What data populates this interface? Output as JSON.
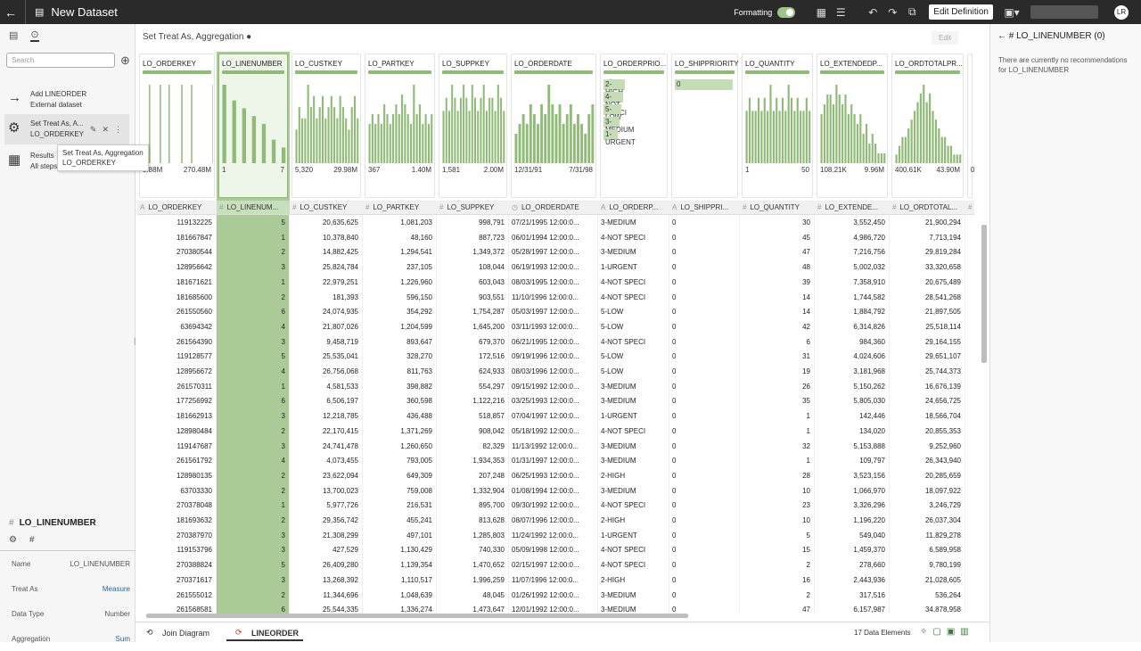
{
  "topbar": {
    "back_icon": "←",
    "dataset_icon": "▤",
    "title": "New Dataset",
    "formatting_label": "Formatting",
    "edit_definition_label": "Edit Definition",
    "avatar": "LR"
  },
  "left": {
    "search_placeholder": "Search",
    "steps": [
      {
        "line1": "Add LINEORDER",
        "line2": "External dataset",
        "icon": "→"
      },
      {
        "line1": "Set Treat As, A...",
        "line2": "LO_ORDERKEY",
        "icon": "⚙"
      },
      {
        "line1": "Results",
        "line2": "All steps combined",
        "icon": "▦"
      }
    ],
    "tooltip": {
      "line1": "Set Treat As, Aggregation",
      "line2": "LO_ORDERKEY"
    },
    "props": {
      "title": "LO_LINENUMBER",
      "type_symbol": "#",
      "rows": [
        {
          "label": "Name",
          "value": "LO_LINENUMBER"
        },
        {
          "label": "Treat As",
          "value": "Measure"
        },
        {
          "label": "Data Type",
          "value": "Number"
        },
        {
          "label": "Aggregation",
          "value": "Sum"
        }
      ]
    }
  },
  "main": {
    "breadcrumb": "Set Treat As, Aggregation ●",
    "edit_label": "Edit"
  },
  "columns": [
    {
      "name": "LO_ORDERKEY",
      "type": "A",
      "min": "5.88M",
      "max": "270.48M",
      "num": true,
      "bars": [
        0,
        0,
        0,
        0,
        0,
        0,
        10,
        0,
        0,
        0,
        0,
        0,
        0,
        0,
        0,
        0,
        0,
        10,
        0,
        0,
        0,
        0,
        0,
        0,
        0,
        0,
        10,
        0,
        0,
        0,
        0,
        0,
        0,
        0,
        0,
        0,
        0,
        0,
        0,
        10,
        0,
        0,
        0,
        0,
        0,
        0,
        0,
        0,
        0,
        10,
        0,
        0,
        0,
        0,
        0,
        0,
        0,
        0,
        0,
        0,
        0,
        0,
        0,
        0,
        0,
        0,
        0,
        0,
        0,
        0,
        0,
        10
      ]
    },
    {
      "name": "LO_LINENUMBER",
      "type": "#",
      "min": "1",
      "max": "7",
      "num": true,
      "bars": [
        10,
        0,
        8,
        0,
        7,
        0,
        6,
        0,
        5,
        0,
        3,
        0,
        2
      ]
    },
    {
      "name": "LO_CUSTKEY",
      "type": "#",
      "min": "5,320",
      "max": "29.98M",
      "num": true,
      "bars": [
        3,
        5,
        4,
        4,
        7,
        5,
        6,
        4,
        5,
        6,
        4,
        5,
        6,
        5,
        4,
        6,
        5,
        4,
        3,
        5,
        6,
        4
      ]
    },
    {
      "name": "LO_PARTKEY",
      "type": "#",
      "min": "367",
      "max": "1.40M",
      "num": true,
      "bars": [
        4,
        5,
        4,
        5,
        4,
        6,
        5,
        4,
        5,
        6,
        5,
        7,
        6,
        5,
        4,
        8,
        5,
        6,
        4,
        5,
        4,
        5
      ]
    },
    {
      "name": "LO_SUPPKEY",
      "type": "#",
      "min": "1,581",
      "max": "2.00M",
      "num": true,
      "bars": [
        4,
        5,
        4,
        6,
        5,
        4,
        5,
        6,
        5,
        4,
        6,
        5,
        4,
        5,
        6,
        4,
        5,
        5,
        4,
        6,
        5,
        4
      ]
    },
    {
      "name": "LO_ORDERDATE",
      "type": "◷",
      "min": "12/31/91",
      "max": "7/31/98",
      "num": false,
      "bars": [
        3,
        4,
        5,
        4,
        6,
        5,
        4,
        6,
        5,
        8,
        6,
        5,
        6,
        4,
        5,
        6,
        4,
        5,
        4,
        3,
        5,
        6
      ]
    },
    {
      "name": "LO_ORDERPRIO...",
      "type": "A",
      "categorical": true,
      "cats": [
        "2-HIGH",
        "4-NOT SPECI",
        "5-LOW",
        "3-MEDIUM",
        "1-URGENT"
      ],
      "num": false
    },
    {
      "name": "LO_SHIPPRIORITY",
      "type": "A",
      "categorical": true,
      "cats": [
        "0"
      ],
      "full": true,
      "num": false
    },
    {
      "name": "LO_QUANTITY",
      "type": "#",
      "min": "1",
      "max": "50",
      "num": true,
      "bars": [
        4,
        5,
        4,
        4,
        5,
        4,
        5,
        4,
        6,
        4,
        5,
        4,
        5,
        4,
        6,
        5,
        4,
        5,
        4,
        4,
        5,
        4
      ]
    },
    {
      "name": "LO_EXTENDEDP...",
      "type": "#",
      "min": "108.21K",
      "max": "9.96M",
      "num": true,
      "bars": [
        5,
        6,
        7,
        7,
        6,
        8,
        7,
        6,
        7,
        5,
        6,
        5,
        4,
        5,
        3,
        4,
        2,
        3,
        2,
        1,
        1,
        1
      ]
    },
    {
      "name": "LO_ORDTOTALPR...",
      "type": "#",
      "min": "400.61K",
      "max": "43.90M",
      "num": true,
      "bars": [
        1,
        2,
        3,
        3,
        4,
        5,
        6,
        7,
        8,
        9,
        7,
        8,
        6,
        5,
        4,
        3,
        3,
        2,
        2,
        1,
        1,
        1
      ]
    },
    {
      "name": "",
      "type": "#",
      "min": "0",
      "max": "",
      "num": true,
      "bars": [
        3,
        0,
        0
      ]
    }
  ],
  "table_headers": [
    "LO_ORDERKEY",
    "LO_LINENUM...",
    "LO_CUSTKEY",
    "LO_PARTKEY",
    "LO_SUPPKEY",
    "LO_ORDERDATE",
    "LO_ORDERP...",
    "LO_SHIPPRI...",
    "LO_QUANTITY",
    "LO_EXTENDE...",
    "LO_ORDTOTAL...",
    ""
  ],
  "rows": [
    [
      "119132225",
      "5",
      "20,635,625",
      "1,081,203",
      "998,791",
      "07/21/1995 12:00:0...",
      "3-MEDIUM",
      "0",
      "30",
      "3,552,450",
      "21,900,294"
    ],
    [
      "181667847",
      "1",
      "10,378,840",
      "48,160",
      "887,723",
      "06/01/1994 12:00:0...",
      "4-NOT SPECI",
      "0",
      "45",
      "4,986,720",
      "7,713,194"
    ],
    [
      "270380544",
      "2",
      "14,882,425",
      "1,294,541",
      "1,349,372",
      "05/28/1997 12:00:0...",
      "3-MEDIUM",
      "0",
      "47",
      "7,216,756",
      "29,819,284"
    ],
    [
      "128956642",
      "3",
      "25,824,784",
      "237,105",
      "108,044",
      "06/19/1993 12:00:0...",
      "1-URGENT",
      "0",
      "48",
      "5,002,032",
      "33,320,658"
    ],
    [
      "181671621",
      "1",
      "22,979,251",
      "1,226,960",
      "603,043",
      "08/03/1995 12:00:0...",
      "4-NOT SPECI",
      "0",
      "39",
      "7,358,910",
      "20,675,489"
    ],
    [
      "181685600",
      "2",
      "181,393",
      "596,150",
      "903,551",
      "11/10/1996 12:00:0...",
      "4-NOT SPECI",
      "0",
      "14",
      "1,744,582",
      "28,541,268"
    ],
    [
      "261550560",
      "6",
      "24,074,935",
      "354,292",
      "1,754,287",
      "05/03/1997 12:00:0...",
      "5-LOW",
      "0",
      "14",
      "1,884,792",
      "21,897,505"
    ],
    [
      "63694342",
      "4",
      "21,807,026",
      "1,204,599",
      "1,645,200",
      "03/11/1993 12:00:0...",
      "5-LOW",
      "0",
      "42",
      "6,314,826",
      "25,518,114"
    ],
    [
      "261564390",
      "3",
      "9,458,719",
      "893,647",
      "679,370",
      "06/21/1995 12:00:0...",
      "4-NOT SPECI",
      "0",
      "6",
      "984,360",
      "29,164,155"
    ],
    [
      "119128577",
      "5",
      "25,535,041",
      "328,270",
      "172,516",
      "09/19/1996 12:00:0...",
      "5-LOW",
      "0",
      "31",
      "4,024,606",
      "29,651,107"
    ],
    [
      "128956672",
      "4",
      "26,756,068",
      "811,763",
      "624,933",
      "08/03/1996 12:00:0...",
      "5-LOW",
      "0",
      "19",
      "3,181,968",
      "25,744,373"
    ],
    [
      "261570311",
      "1",
      "4,581,533",
      "398,882",
      "554,297",
      "09/15/1992 12:00:0...",
      "3-MEDIUM",
      "0",
      "26",
      "5,150,262",
      "16,676,139"
    ],
    [
      "177256992",
      "6",
      "6,506,197",
      "360,598",
      "1,122,216",
      "03/25/1993 12:00:0...",
      "3-MEDIUM",
      "0",
      "35",
      "5,805,030",
      "24,656,725"
    ],
    [
      "181662913",
      "3",
      "12,218,785",
      "436,488",
      "518,857",
      "07/04/1997 12:00:0...",
      "1-URGENT",
      "0",
      "1",
      "142,446",
      "18,566,704"
    ],
    [
      "128980484",
      "2",
      "22,170,415",
      "1,371,269",
      "908,042",
      "05/18/1992 12:00:0...",
      "4-NOT SPECI",
      "0",
      "1",
      "134,020",
      "20,855,353"
    ],
    [
      "119147687",
      "3",
      "24,741,478",
      "1,260,650",
      "82,329",
      "11/13/1992 12:00:0...",
      "3-MEDIUM",
      "0",
      "32",
      "5,153,888",
      "9,252,960"
    ],
    [
      "261561792",
      "4",
      "4,073,455",
      "793,005",
      "1,934,353",
      "01/31/1997 12:00:0...",
      "3-MEDIUM",
      "0",
      "1",
      "109,797",
      "26,343,940"
    ],
    [
      "128980135",
      "2",
      "23,622,094",
      "649,309",
      "207,248",
      "06/25/1993 12:00:0...",
      "2-HIGH",
      "0",
      "28",
      "3,523,156",
      "20,285,659"
    ],
    [
      "63703330",
      "2",
      "13,700,023",
      "759,008",
      "1,332,904",
      "01/08/1994 12:00:0...",
      "3-MEDIUM",
      "0",
      "10",
      "1,066,970",
      "18,097,922"
    ],
    [
      "270378048",
      "1",
      "5,977,726",
      "216,531",
      "895,700",
      "09/30/1992 12:00:0...",
      "4-NOT SPECI",
      "0",
      "23",
      "3,326,296",
      "3,246,729"
    ],
    [
      "181693632",
      "2",
      "29,356,742",
      "455,241",
      "813,628",
      "08/07/1996 12:00:0...",
      "2-HIGH",
      "0",
      "10",
      "1,196,220",
      "26,037,304"
    ],
    [
      "270387970",
      "3",
      "21,308,299",
      "497,101",
      "1,285,803",
      "11/24/1992 12:00:0...",
      "1-URGENT",
      "0",
      "5",
      "549,040",
      "11,829,278"
    ],
    [
      "119153796",
      "3",
      "427,529",
      "1,130,429",
      "740,330",
      "05/09/1998 12:00:0...",
      "4-NOT SPECI",
      "0",
      "15",
      "1,459,370",
      "6,589,958"
    ],
    [
      "270388824",
      "5",
      "26,409,280",
      "1,139,354",
      "1,470,652",
      "02/15/1997 12:00:0...",
      "4-NOT SPECI",
      "0",
      "2",
      "278,660",
      "9,780,199"
    ],
    [
      "270371617",
      "3",
      "13,268,392",
      "1,110,517",
      "1,996,259",
      "11/07/1996 12:00:0...",
      "2-HIGH",
      "0",
      "16",
      "2,443,936",
      "21,028,605"
    ],
    [
      "261555012",
      "2",
      "11,344,696",
      "1,048,639",
      "48,045",
      "01/26/1992 12:00:0...",
      "3-MEDIUM",
      "0",
      "2",
      "317,516",
      "536,264"
    ],
    [
      "261568581",
      "6",
      "25,544,335",
      "1,336,274",
      "1,473,647",
      "12/01/1992 12:00:0...",
      "3-MEDIUM",
      "0",
      "47",
      "6,157,987",
      "34,878,958"
    ]
  ],
  "bottom": {
    "join_label": "Join Diagram",
    "tab_label": "LINEORDER",
    "count_label": "17 Data Elements"
  },
  "right": {
    "title": "LO_LINENUMBER (0)",
    "message": "There are currently no recommendations for LO_LINENUMBER"
  },
  "colors": {
    "accent": "#8fbb77",
    "selected": "#aacb98",
    "topbar": "#2a2a2a"
  }
}
